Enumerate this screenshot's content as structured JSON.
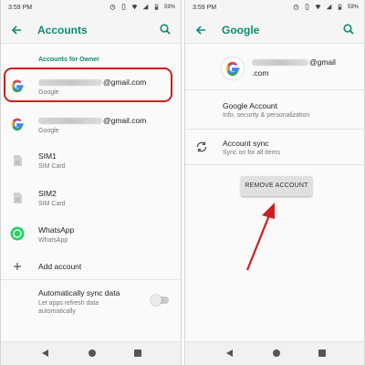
{
  "colors": {
    "accent": "#138a72",
    "highlight": "#cc1f1f",
    "arrow": "#cc1f1f",
    "whatsapp": "#25d366"
  },
  "left": {
    "statusbar": {
      "time": "3:59 PM",
      "battery": "59%"
    },
    "appbar": {
      "title": "Accounts",
      "back_icon": "arrow-back-icon",
      "search_icon": "search-icon"
    },
    "section_header": "Accounts for Owner",
    "accounts": [
      {
        "email_suffix": "@gmail.com",
        "type": "Google",
        "icon": "google-icon"
      },
      {
        "email_suffix": "@gmail.com",
        "type": "Google",
        "icon": "google-icon"
      },
      {
        "name": "SIM1",
        "type": "SIM Card",
        "icon": "sim-card-icon"
      },
      {
        "name": "SIM2",
        "type": "SIM Card",
        "icon": "sim-card-icon"
      },
      {
        "name": "WhatsApp",
        "type": "WhatsApp",
        "icon": "whatsapp-icon"
      }
    ],
    "add_account": "Add account",
    "sync": {
      "title": "Automatically sync data",
      "subtitle_line1": "Let apps refresh data",
      "subtitle_line2": "automatically",
      "enabled": false
    }
  },
  "right": {
    "statusbar": {
      "time": "3:59 PM",
      "battery": "59%"
    },
    "appbar": {
      "title": "Google",
      "back_icon": "arrow-back-icon",
      "search_icon": "search-icon"
    },
    "account": {
      "email_suffix": "@gmail",
      "email_domain": ".com"
    },
    "google_account": {
      "title": "Google Account",
      "subtitle": "Info, security & personalization"
    },
    "account_sync": {
      "title": "Account sync",
      "subtitle": "Sync on for all items"
    },
    "remove_button": "REMOVE ACCOUNT"
  }
}
